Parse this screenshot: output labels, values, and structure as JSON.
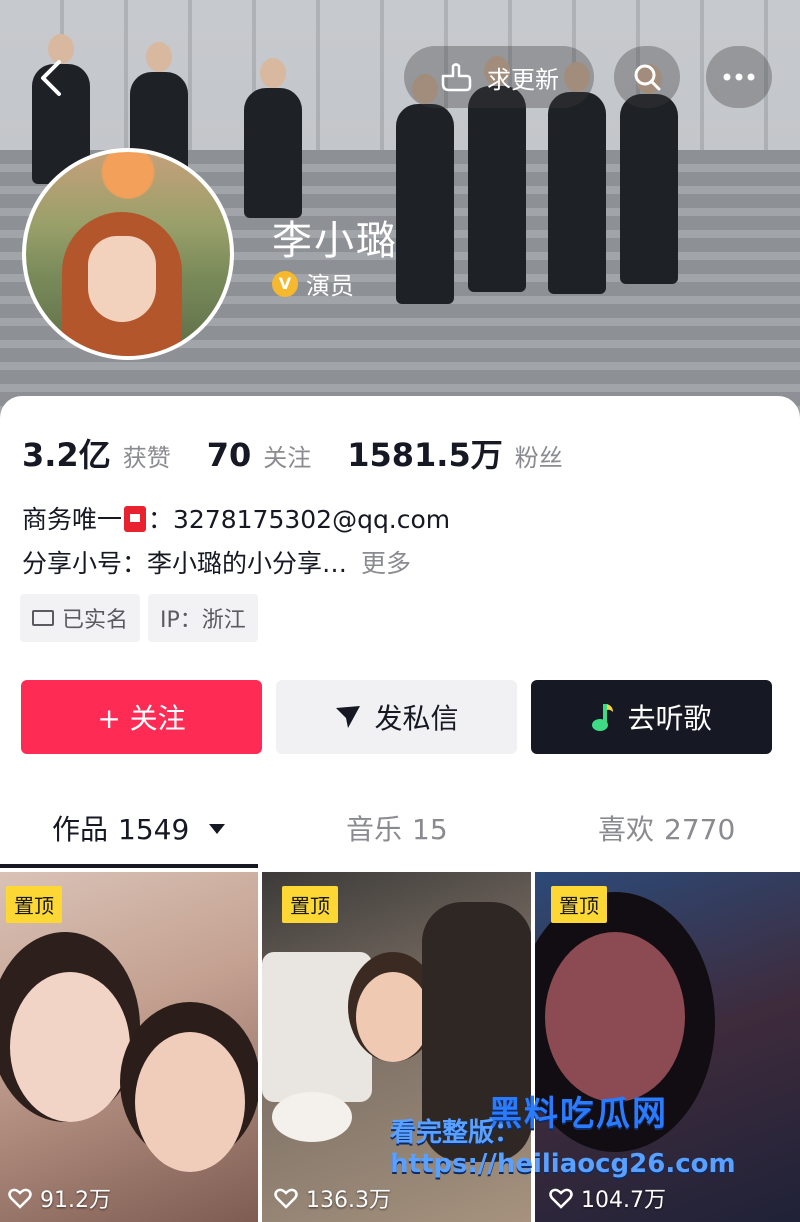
{
  "header": {
    "update_request_label": "求更新",
    "name": "李小璐",
    "role": "演员",
    "verified_glyph": "V"
  },
  "stats": [
    {
      "value": "3.2亿",
      "label": "获赞"
    },
    {
      "value": "70",
      "label": "关注"
    },
    {
      "value": "1581.5万",
      "label": "粉丝"
    }
  ],
  "bio": {
    "line1_prefix": "商务唯一",
    "line1_suffix": "：3278175302@qq.com",
    "line2": "分享小号：李小璐的小分享…",
    "more_label": "更多"
  },
  "tags": {
    "verified_label": "已实名",
    "ip_label": "IP：浙江"
  },
  "actions": {
    "follow_label": "+ 关注",
    "message_label": "发私信",
    "song_label": "去听歌"
  },
  "tabs": [
    {
      "label": "作品",
      "count": "1549",
      "active": true
    },
    {
      "label": "音乐",
      "count": "15",
      "active": false
    },
    {
      "label": "喜欢",
      "count": "2770",
      "active": false
    }
  ],
  "videos": [
    {
      "pin_label": "置顶",
      "likes": "91.2万"
    },
    {
      "pin_label": "置顶",
      "likes": "136.3万"
    },
    {
      "pin_label": "置顶",
      "likes": "104.7万"
    }
  ],
  "watermark": {
    "title": "黑料吃瓜网",
    "url_line": "看完整版：https://heiliaocg26.com"
  },
  "colors": {
    "follow": "#fe2c55",
    "dark_button": "#161823",
    "pin": "#fdd835"
  }
}
